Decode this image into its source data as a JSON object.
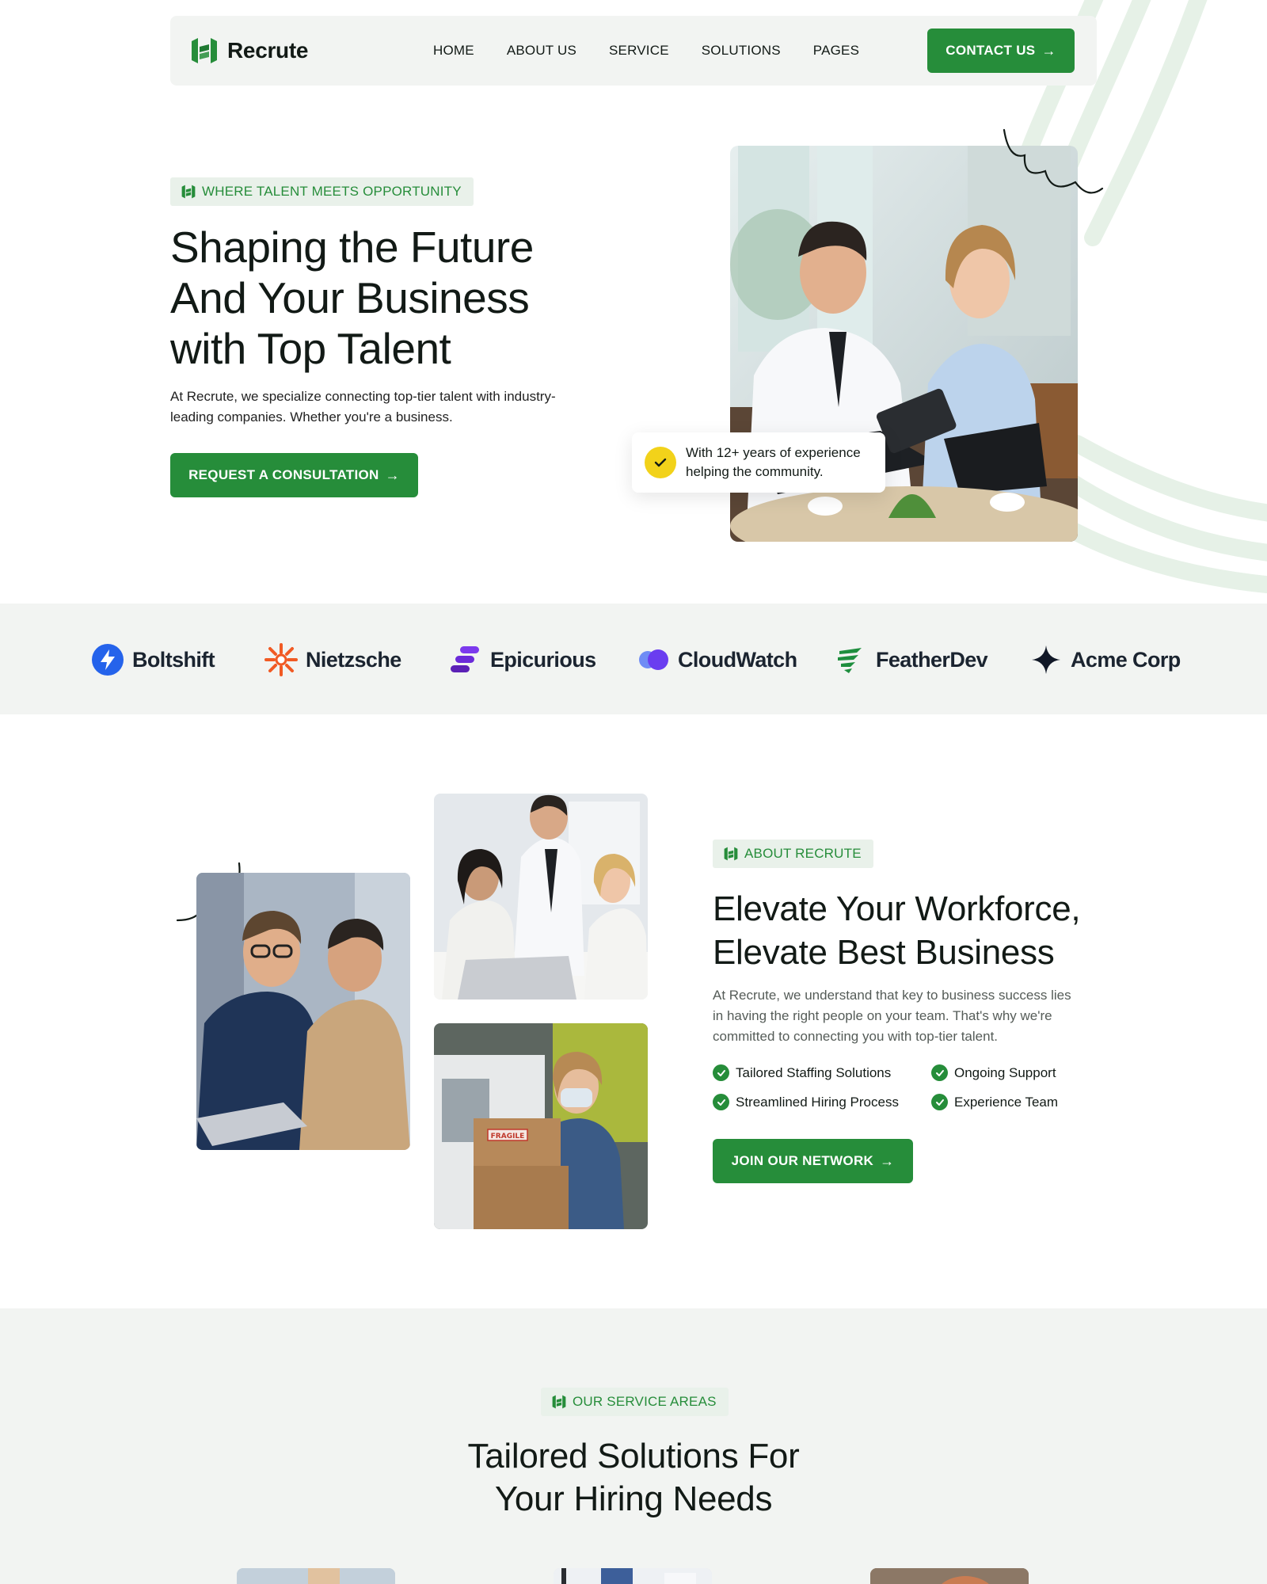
{
  "brand": {
    "name": "Recrute",
    "logo_icon": "recrute-logo-icon"
  },
  "nav": {
    "links": [
      "HOME",
      "ABOUT US",
      "SERVICE",
      "SOLUTIONS",
      "PAGES"
    ],
    "contact_label": "CONTACT US"
  },
  "hero": {
    "tag": "WHERE TALENT MEETS OPPORTUNITY",
    "title_lines": [
      "Shaping the Future",
      "And Your Business",
      "with Top Talent"
    ],
    "description": "At Recrute, we specialize connecting top-tier talent with industry-leading companies. Whether you're a business.",
    "cta_label": "REQUEST A CONSULTATION",
    "experience_text": "With 12+ years of experience helping the community.",
    "photo_alt": "Two professionals reviewing a tablet"
  },
  "partners": [
    {
      "name": "Boltshift",
      "icon": "bolt-icon",
      "color": "#2563eb"
    },
    {
      "name": "Nietzsche",
      "icon": "sunburst-icon",
      "color": "#f15a24"
    },
    {
      "name": "Epicurious",
      "icon": "stacked-bars-icon",
      "color": "#6b2bd9"
    },
    {
      "name": "CloudWatch",
      "icon": "cloud-dots-icon",
      "color": "#5b3df0"
    },
    {
      "name": "FeatherDev",
      "icon": "feather-icon",
      "color": "#1e8e3e"
    },
    {
      "name": "Acme Corp",
      "icon": "sparkle-icon",
      "color": "#111827"
    }
  ],
  "about": {
    "tag": "ABOUT RECRUTE",
    "title_lines": [
      "Elevate Your Workforce,",
      "Elevate Best Business"
    ],
    "description": "At Recrute, we understand that key to business success lies in having the right people on your team. That's why we're committed to connecting you with top-tier talent.",
    "features": [
      "Tailored Staffing Solutions",
      "Ongoing Support",
      "Streamlined Hiring Process",
      "Experience Team"
    ],
    "cta_label": "JOIN OUR NETWORK",
    "box_label": "FRAGILE"
  },
  "services": {
    "tag": "OUR SERVICE AREAS",
    "title_lines": [
      "Tailored Solutions For",
      "Your Hiring Needs"
    ]
  },
  "colors": {
    "accent": "#268d3a",
    "tag_bg": "#e9f1ea",
    "band_bg": "#f2f4f2",
    "check_yellow": "#f2d21a"
  }
}
